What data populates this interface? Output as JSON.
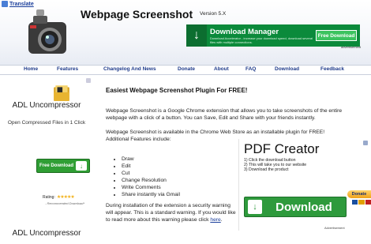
{
  "header": {
    "translate_label": "Translate",
    "title": "Webpage Screenshot",
    "version": "Version 5.X"
  },
  "top_ad": {
    "title": "Download Manager",
    "subtitle": "Download Accelerator - increase your download speed, download several files with multiple connections.",
    "button": "Free Download",
    "label": "advertisement"
  },
  "nav": {
    "items": [
      "Home",
      "Features",
      "Changelog And News",
      "Donate",
      "About",
      "FAQ",
      "Download",
      "Feedback"
    ]
  },
  "sidebar": {
    "ad_title_1": "ADL Uncompressor",
    "ad_title_2": "ADL Uncompressor",
    "subtitle": "Open Compressed Files in 1 Click",
    "button": "Free Download",
    "rating_label": "Rating:",
    "rating_stars": "★★★★★",
    "recommended": "- Recommended Download*"
  },
  "main": {
    "heading": "Easiest Webpage Screenshot Plugin For FREE!",
    "para1": "Webpage Screenshot is a Google Chrome extension that allows you to take screenshots of the entire webpage with a click of a button. You can Save, Edit and Share with your friends instantly.",
    "para2": "Webpage Screenshot is available in the Chrome Web Store as an installable plugin for FREE! Additional Features include:",
    "features": [
      "Draw",
      "Edit",
      "Cut",
      "Change Resolution",
      "Write Comments",
      "Share instantly via Gmail"
    ],
    "para3": "During installation of the extension a security warning will appear. This is a standard warning. If you would like to read more about this warning please click",
    "para3_link": "here"
  },
  "pdf_ad": {
    "title": "PDF Creator",
    "steps": [
      "1) Click the download button",
      "2) This will take you to our website",
      "3) Download the product"
    ],
    "button": "Download",
    "label": "Advertisement"
  },
  "donate": {
    "label": "Donate"
  },
  "colors": {
    "nav_link": "#1e3a8a",
    "ad_green": "#2e9a3c",
    "donate_gold": "#f0a21a"
  }
}
